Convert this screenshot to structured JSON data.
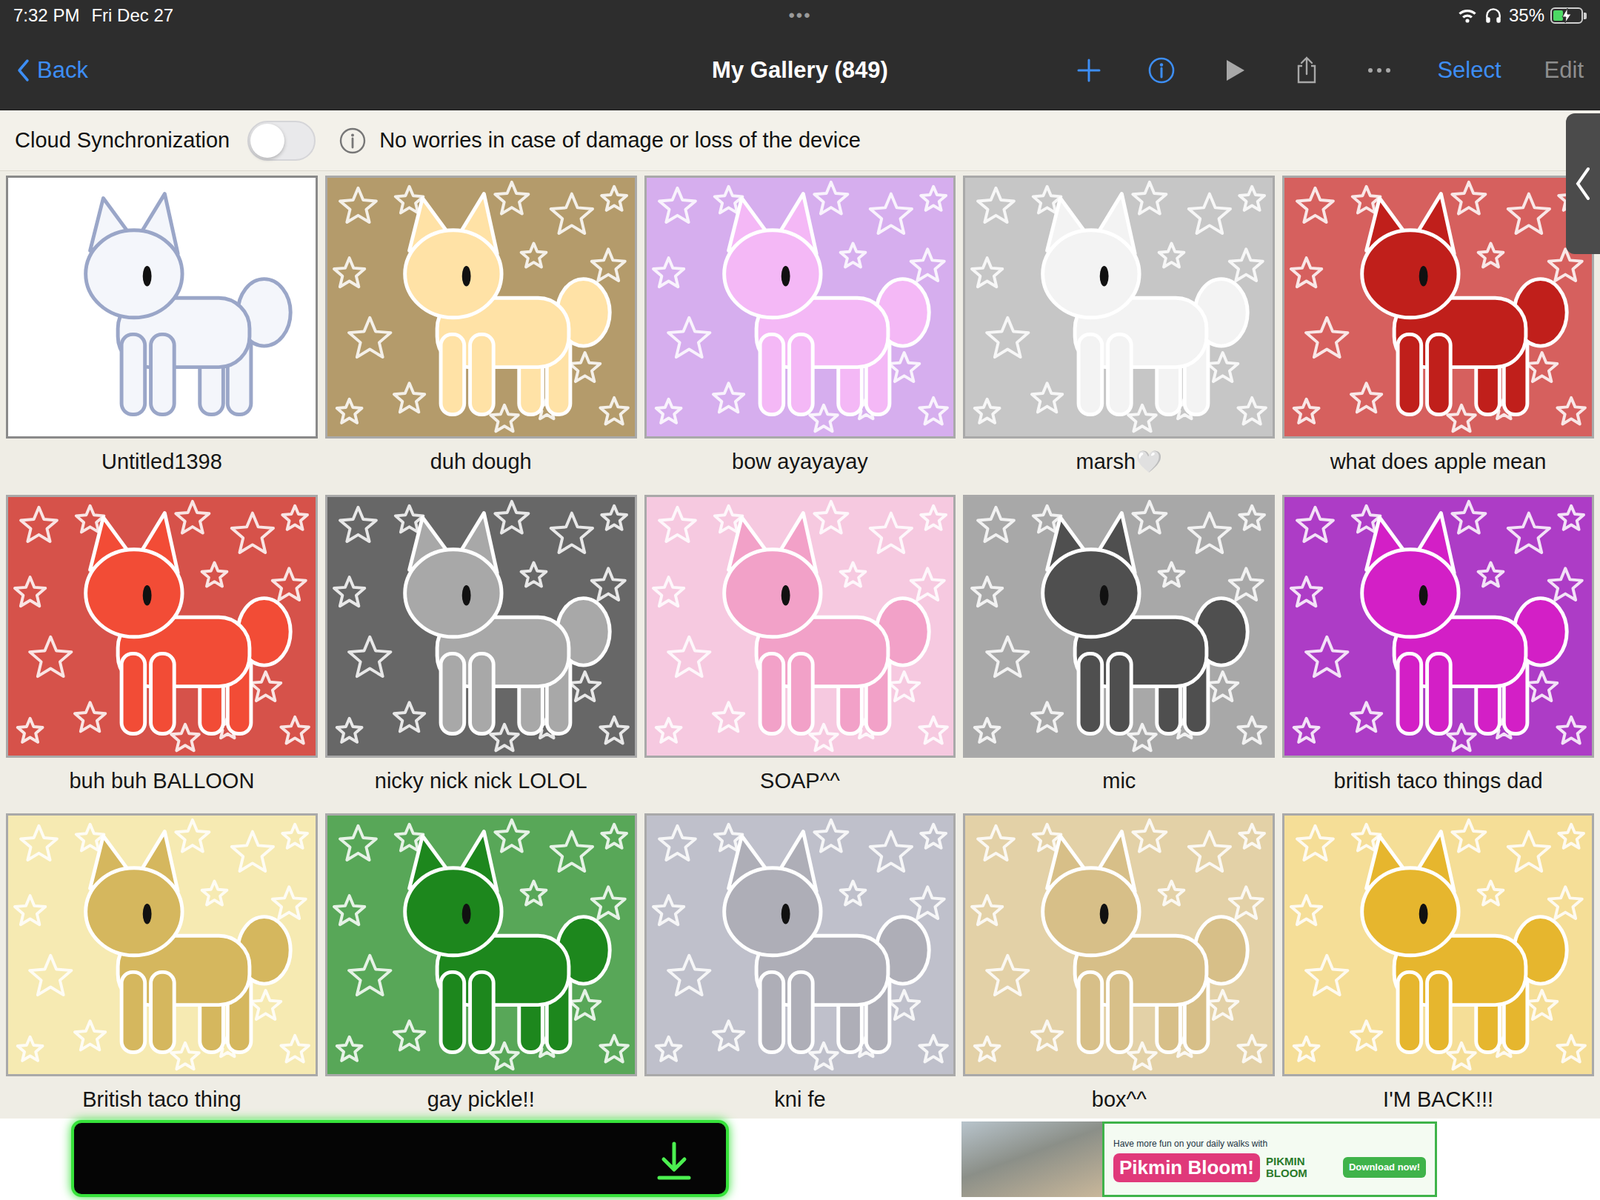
{
  "status_bar": {
    "time": "7:32 PM",
    "date": "Fri Dec 27",
    "dots": "•••",
    "battery": {
      "reading": "35%",
      "level": 0.35,
      "charging": true
    }
  },
  "nav": {
    "back": "Back",
    "title": "My Gallery (849)",
    "select": "Select",
    "edit": "Edit",
    "edit_disabled": true
  },
  "cloud": {
    "label": "Cloud Synchronization",
    "on": false,
    "note": "No worries in case of damage or loss of the device"
  },
  "gallery": {
    "items": [
      {
        "title": "Untitled1398",
        "kind": "sketch",
        "color": "#ffffff",
        "figure_color": "#f4f6fb"
      },
      {
        "title": "duh dough",
        "kind": "card",
        "color": "#b49b6b",
        "figure_color": "#ffe2a6"
      },
      {
        "title": "bow ayayayay",
        "kind": "card",
        "color": "#d6aeee",
        "figure_color": "#f4b8f6"
      },
      {
        "title": "marsh🤍",
        "kind": "card",
        "color": "#c6c6c6",
        "figure_color": "#f3f3f3"
      },
      {
        "title": "what does apple mean",
        "kind": "card",
        "color": "#d6605e",
        "figure_color": "#c01f1b"
      },
      {
        "title": "buh buh BALLOON",
        "kind": "card",
        "color": "#d6524a",
        "figure_color": "#f24c36"
      },
      {
        "title": "nicky nick nick LOLOL",
        "kind": "card",
        "color": "#676767",
        "figure_color": "#a8a8a8"
      },
      {
        "title": "SOAP^^",
        "kind": "card",
        "color": "#f6c9e0",
        "figure_color": "#f2a1c8"
      },
      {
        "title": "mic",
        "kind": "card",
        "color": "#a8a8a8",
        "figure_color": "#4f4f4f"
      },
      {
        "title": "british taco things dad",
        "kind": "card",
        "color": "#ad3cc6",
        "figure_color": "#d31fc6"
      },
      {
        "title": "British taco thing",
        "kind": "card",
        "color": "#f6eab2",
        "figure_color": "#d5b75e"
      },
      {
        "title": "gay pickle!!",
        "kind": "card",
        "color": "#58a758",
        "figure_color": "#1d871d"
      },
      {
        "title": "kni fe",
        "kind": "card",
        "color": "#bfc0cb",
        "figure_color": "#aeaeb7"
      },
      {
        "title": "box^^",
        "kind": "card",
        "color": "#e3d1a7",
        "figure_color": "#d7bf88"
      },
      {
        "title": "I'M BACK!!!",
        "kind": "card",
        "color": "#f5de97",
        "figure_color": "#e6b62e"
      }
    ]
  },
  "ads": {
    "right": {
      "tagline": "Have more fun on your daily walks with",
      "brand": "Pikmin Bloom!",
      "logo": "PIKMIN BLOOM",
      "cta": "Download now!"
    }
  }
}
